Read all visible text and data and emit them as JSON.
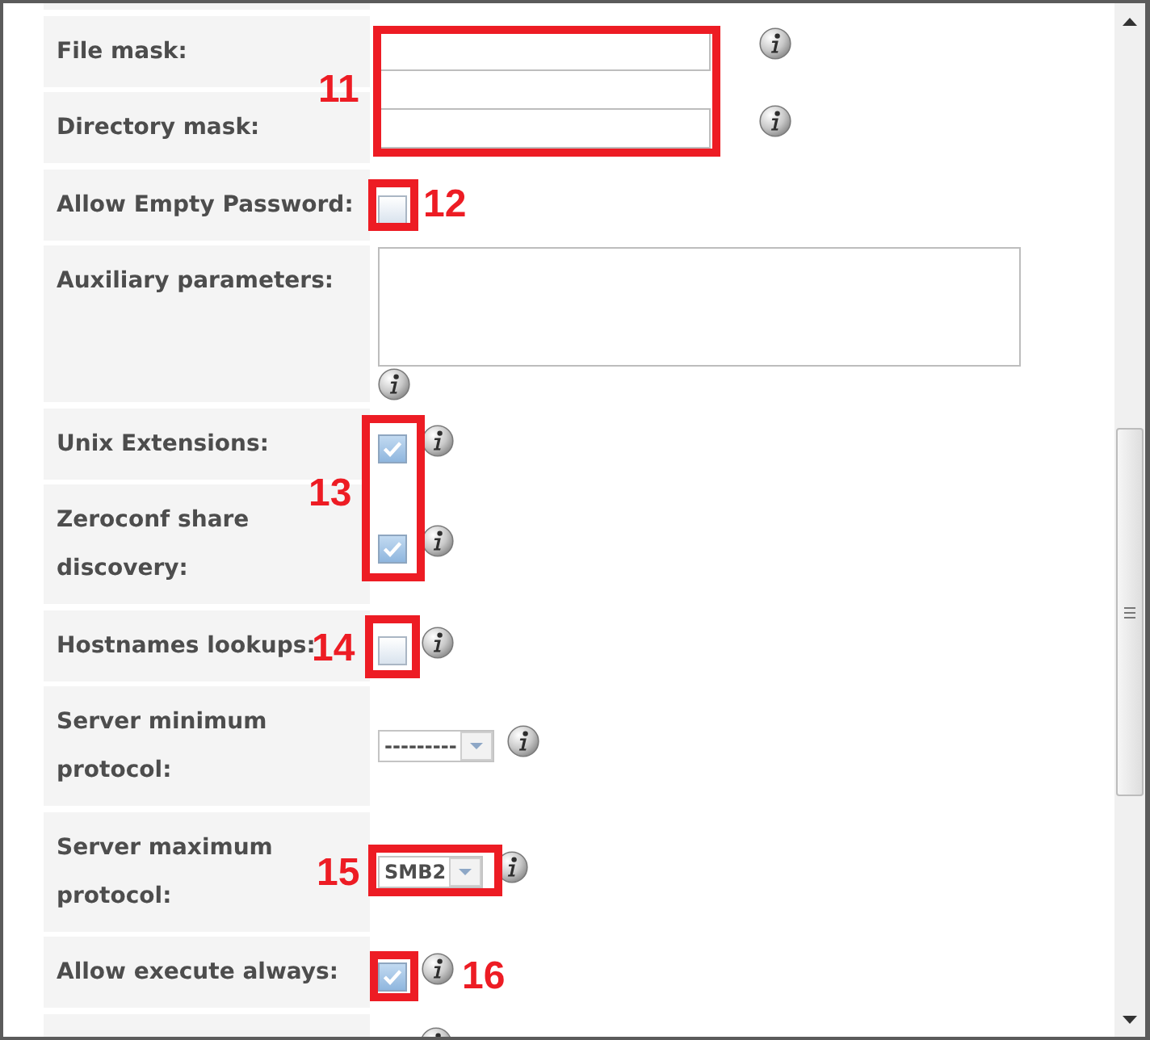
{
  "form": {
    "rows": [
      {
        "kind": "cutoff"
      },
      {
        "kind": "text",
        "label": "File mask:",
        "info": true
      },
      {
        "kind": "text",
        "label": "Directory mask:",
        "info": true
      },
      {
        "kind": "checkbox",
        "label": "Allow Empty Password:",
        "checked": false,
        "info": false
      },
      {
        "kind": "textarea",
        "label": "Auxiliary parameters:",
        "info": true
      },
      {
        "kind": "checkbox",
        "label": "Unix Extensions:",
        "checked": true,
        "info": true
      },
      {
        "kind": "checkbox",
        "label": "Zeroconf share discovery:",
        "checked": true,
        "info": true
      },
      {
        "kind": "checkbox",
        "label": "Hostnames lookups:",
        "checked": false,
        "info": true
      },
      {
        "kind": "select",
        "label": "Server minimum protocol:",
        "value": "---------",
        "info": true
      },
      {
        "kind": "select",
        "label": "Server maximum protocol:",
        "value": "SMB2",
        "info": true
      },
      {
        "kind": "checkbox",
        "label": "Allow execute always:",
        "checked": true,
        "info": true
      },
      {
        "kind": "cutoff",
        "info": true
      }
    ]
  },
  "annotations": [
    {
      "number": "11"
    },
    {
      "number": "12"
    },
    {
      "number": "13"
    },
    {
      "number": "14"
    },
    {
      "number": "15"
    },
    {
      "number": "16"
    }
  ]
}
